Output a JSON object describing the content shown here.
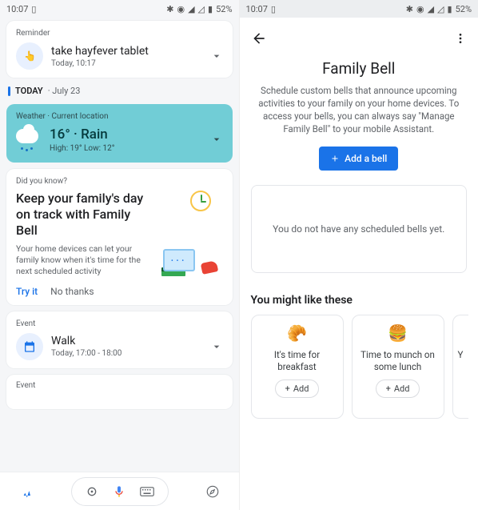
{
  "status_bar": {
    "time": "10:07",
    "battery_text": "52%"
  },
  "left": {
    "reminder": {
      "section_label": "Reminder",
      "title": "take hayfever tablet",
      "subtitle": "Today, 10:17"
    },
    "today_header": {
      "label": "TODAY",
      "date": "· July 23"
    },
    "weather": {
      "label": "Weather · Current location",
      "temp_line": "16° · Rain",
      "range_line": "High: 19° Low: 12°"
    },
    "did_you_know": {
      "section_label": "Did you know?",
      "title": "Keep your family's day on track with Family Bell",
      "desc": "Your home devices can let your family know when it's time for the next scheduled activity",
      "try_label": "Try it",
      "no_thanks_label": "No thanks"
    },
    "event": {
      "section_label": "Event",
      "title": "Walk",
      "subtitle": "Today, 17:00 - 18:00"
    },
    "event_stub_label": "Event"
  },
  "right": {
    "title": "Family Bell",
    "desc": "Schedule custom bells that announce upcoming activities to your family on your home devices. To access your bells, you can always say \"Manage Family Bell\" to your mobile Assistant.",
    "add_bell_label": "Add a bell",
    "empty_state": "You do not have any scheduled bells yet.",
    "suggestions_header": "You might like these",
    "suggestions": [
      {
        "text": "It's time for breakfast",
        "add_label": "Add"
      },
      {
        "text": "Time to munch on some lunch",
        "add_label": "Add"
      },
      {
        "text": "Y"
      }
    ]
  }
}
